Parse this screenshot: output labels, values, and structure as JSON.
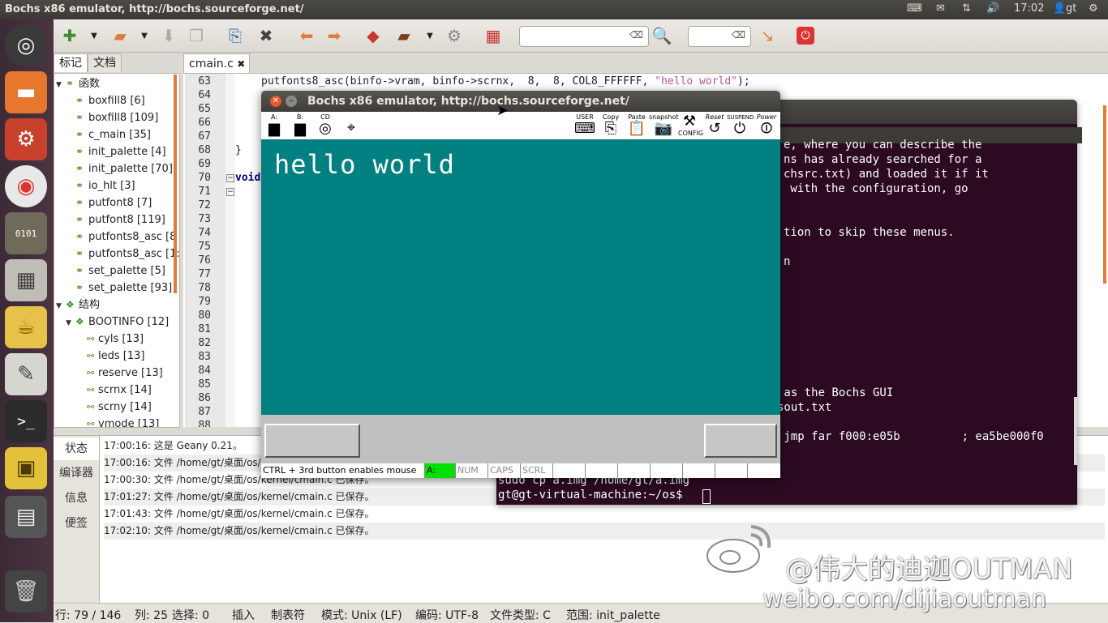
{
  "top_panel": {
    "window_title": "Bochs x86 emulator, http://bochs.sourceforge.net/",
    "clock": "17:02",
    "user": "gt"
  },
  "geany": {
    "side_tabs": [
      "标记",
      "文档"
    ],
    "editor_tab": "cmain.c",
    "tree": [
      {
        "kind": "group",
        "label": "函数",
        "indent": 0
      },
      {
        "kind": "leaf",
        "label": "boxfill8 [6]",
        "indent": 1
      },
      {
        "kind": "leaf",
        "label": "boxfill8 [109]",
        "indent": 1
      },
      {
        "kind": "leaf",
        "label": "c_main [35]",
        "indent": 1
      },
      {
        "kind": "leaf",
        "label": "init_palette [4]",
        "indent": 1
      },
      {
        "kind": "leaf",
        "label": "init_palette [70]",
        "indent": 1
      },
      {
        "kind": "leaf",
        "label": "io_hlt [3]",
        "indent": 1
      },
      {
        "kind": "leaf",
        "label": "putfont8 [7]",
        "indent": 1
      },
      {
        "kind": "leaf",
        "label": "putfont8 [119]",
        "indent": 1
      },
      {
        "kind": "leaf",
        "label": "putfonts8_asc [8",
        "indent": 1
      },
      {
        "kind": "leaf",
        "label": "putfonts8_asc [1:",
        "indent": 1
      },
      {
        "kind": "leaf",
        "label": "set_palette [5]",
        "indent": 1
      },
      {
        "kind": "leaf",
        "label": "set_palette [93]",
        "indent": 1
      },
      {
        "kind": "group",
        "label": "结构",
        "indent": 0
      },
      {
        "kind": "struct",
        "label": "BOOTINFO [12]",
        "indent": 1
      },
      {
        "kind": "member",
        "label": "cyls [13]",
        "indent": 2
      },
      {
        "kind": "member",
        "label": "leds [13]",
        "indent": 2
      },
      {
        "kind": "member",
        "label": "reserve [13]",
        "indent": 2
      },
      {
        "kind": "member",
        "label": "scrnx [14]",
        "indent": 2
      },
      {
        "kind": "member",
        "label": "scrny [14]",
        "indent": 2
      },
      {
        "kind": "member",
        "label": "vmode [13]",
        "indent": 2
      }
    ],
    "line_numbers": [
      "63",
      "64",
      "65",
      "66",
      "67",
      "68",
      "69",
      "70",
      "71",
      "72",
      "73",
      "74",
      "75",
      "76",
      "77",
      "78",
      "79",
      "80",
      "81",
      "82",
      "83",
      "84",
      "85",
      "86",
      "87",
      "88"
    ],
    "code": {
      "line63_pre": "putfonts8_asc(binfo->vram, binfo->scrnx,  8,  8, COL8_FFFFFF, ",
      "line63_str": "\"hello world\"",
      "line63_post": ");",
      "line68": "}",
      "line70": "void"
    },
    "message_tabs": [
      "状态",
      "编译器",
      "信息",
      "便签"
    ],
    "messages": [
      "17:00:16: 这是 Geany 0.21。",
      "17:00:16: 文件 /home/gt/桌面/os/kernel/cmain.c 已保存。",
      "17:00:30: 文件 /home/gt/桌面/os/kernel/cmain.c 已保存。",
      "17:01:27: 文件 /home/gt/桌面/os/kernel/cmain.c 已保存。",
      "17:01:43: 文件 /home/gt/桌面/os/kernel/cmain.c 已保存。",
      "17:02:10: 文件 /home/gt/桌面/os/kernel/cmain.c 已保存。"
    ],
    "status": {
      "line": "行: 79 / 146",
      "col": "列: 25",
      "sel": "选择: 0",
      "ins": "插入",
      "tab": "制表符",
      "mode": "模式: Unix (LF)",
      "enc": "编码: UTF-8",
      "ftype": "文件类型: C",
      "scope": "范围: init_palette"
    }
  },
  "terminal": {
    "lines": [
      "e, where you can describe the",
      "ns has already searched for a",
      "chsrc.txt) and loaded it if it",
      " with the configuration, go",
      "",
      "",
      "tion to skip these menus.",
      "",
      "n"
    ],
    "lower_lines": [
      " as the Bochs GUI",
      "sout.txt"
    ],
    "disasm": " jmp far f000:e05b         ; ea5be000f0",
    "cmd": "sudo cp a.img /home/gt/a.img",
    "prompt": "gt@gt-virtual-machine:~/os$ "
  },
  "bochs": {
    "title": "Bochs x86 emulator, http://bochs.sourceforge.net/",
    "tools": [
      "A:",
      "B:",
      "CD",
      "USER",
      "Copy",
      "Paste",
      "snapshot",
      "CONFIG",
      "Reset",
      "SUSPEND",
      "Power"
    ],
    "screen_text": "hello world",
    "status": [
      "CTRL + 3rd button enables mouse",
      "A:",
      "NUM",
      "CAPS",
      "SCRL"
    ],
    "colors": {
      "screen": "#008080",
      "led_on": "#00ff00"
    }
  },
  "watermark": {
    "name": "@伟大的迪迦OUTMAN",
    "url": "weibo.com/dijiaoutman"
  }
}
